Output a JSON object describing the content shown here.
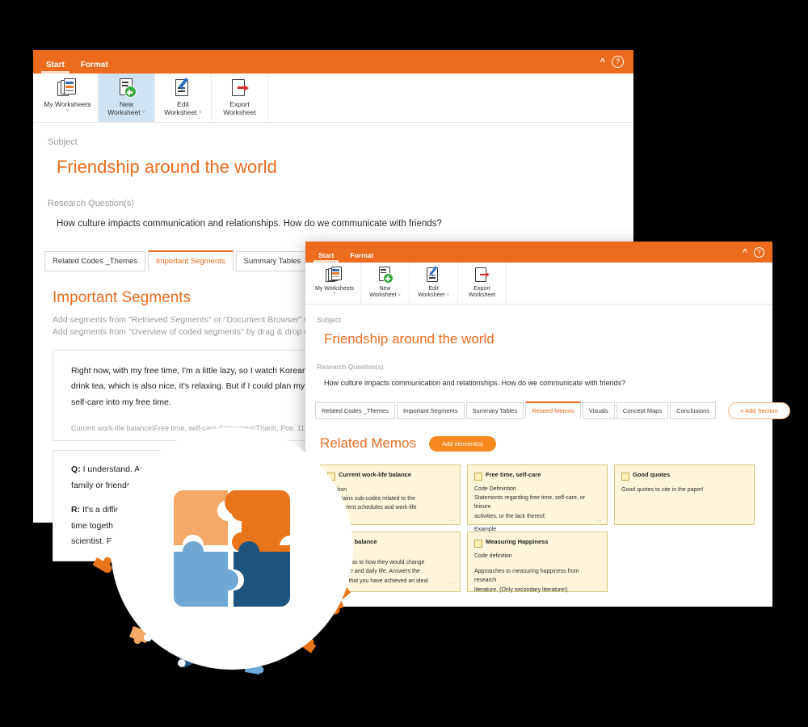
{
  "app": {
    "ribbon_tabs": [
      "Start",
      "Format"
    ],
    "active_ribbon_tab": "Start",
    "help_icon": "question-circle-icon",
    "collapse_icon": "chevron-up-icon",
    "accent": "#ed6b1f",
    "selected_tool_bg": "#cfe3f3"
  },
  "toolbar": {
    "items": [
      {
        "line1": "My Worksheets",
        "line2": "",
        "caret": true,
        "icon": "my-worksheets-icon"
      },
      {
        "line1": "New",
        "line2": "Worksheet",
        "caret": true,
        "icon": "new-worksheet-icon"
      },
      {
        "line1": "Edit",
        "line2": "Worksheet",
        "caret": true,
        "icon": "edit-worksheet-icon"
      },
      {
        "line1": "Export",
        "line2": "Worksheet",
        "caret": false,
        "icon": "export-worksheet-icon"
      }
    ]
  },
  "back_window": {
    "subject_label": "Subject",
    "subject_value": "Friendship around the world",
    "research_label": "Research Question(s)",
    "research_value": "How culture impacts communication and relationships. How do we communicate with friends?",
    "tabs": [
      "Related Codes _Themes",
      "Important Segments",
      "Summary Tables",
      "Related Memos"
    ],
    "active_tab": "Important Segments",
    "section_title": "Important Segments",
    "hint_line1": "Add segments from \"Retrieved Segments\" or \"Document Browser\" window",
    "hint_line2": "Add segments from \"Overview of coded segments\" by drag & drop of se",
    "segments": [
      {
        "text": "Right now, with my free time, I'm a little lazy, so I watch Korean drama, or I just go to my neighbor's and then have a chat and drink tea, which is also nice, it's relaxing. But if I could plan my free time better, then I think I could. I would like to put some more self-care into my free time.",
        "meta": "Current work-life balance\\Free time, self-care (Interviews\\Thanh, Pos. 11) (Weight score: 50)"
      },
      {
        "q_label": "Q:",
        "q_text": " I understand. And how satisf",
        "q_text2": "family or friends?",
        "r_label": "R:",
        "r_text": " It's a difficult question",
        "r_text2": "time together. But this",
        "r_text3": "scientist. For my frien"
      }
    ]
  },
  "front_window": {
    "subject_label": "Subject",
    "subject_value": "Friendship around the world",
    "research_label": "Research Question(s)",
    "research_value": "How culture impacts communication and relationships. How do we communicate with friends?",
    "tabs": [
      "Related Codes _Themes",
      "Important Segments",
      "Summary Tables",
      "Related Memos",
      "Visuals",
      "Concept Maps",
      "Conclusions"
    ],
    "active_tab": "Related Memos",
    "add_section_label": "+ Add Section",
    "section_title": "Related Memos",
    "add_elements_label": "Add element(s)",
    "memos": [
      {
        "title": "Current work-life balance",
        "title_visible": "Current work-life balance",
        "body": "Code Definition\nThis code contains sub-codes related to the description of current schedules and work-life",
        "body_visible_l1": "efinition",
        "body_visible_l2": "e contains sub-codes related to the",
        "body_visible_l3": "n of current schedules and work-life",
        "occluded": true
      },
      {
        "title": "Free time, self-care",
        "body_l1": "Code Definintion",
        "body_l2": "Statements regarding free time, self-care, or leisure",
        "body_l3": "activities, or the lack thereof.",
        "body_l4": "Example",
        "occluded": false
      },
      {
        "title": "Good quotes",
        "body_l1": "Good quotes to cite in the paper!",
        "occluded": false
      },
      {
        "title": "Ideal work-life balance",
        "title_visible": "k-life balance",
        "body_visible_l1": "on",
        "body_visible_l2": "s' wishes as to how they would change",
        "body_visible_l3": "t schedule and daily life. Answers the",
        "body_visible_l4": "imagine that you have achieved an ideal",
        "occluded": true
      },
      {
        "title": "Measuring Happiness",
        "body_l1": "Code definition",
        "body_l2": "",
        "body_l3": "Approaches to measuring happiness from research",
        "body_l4": "literature. (Only secondary literature!)",
        "occluded": false
      }
    ]
  },
  "logo": {
    "name": "puzzle-logo",
    "colors": {
      "top_left": "#f5a968",
      "top_right": "#e8751a",
      "bottom_left": "#6fa8d4",
      "bottom_right": "#1f5480"
    }
  }
}
